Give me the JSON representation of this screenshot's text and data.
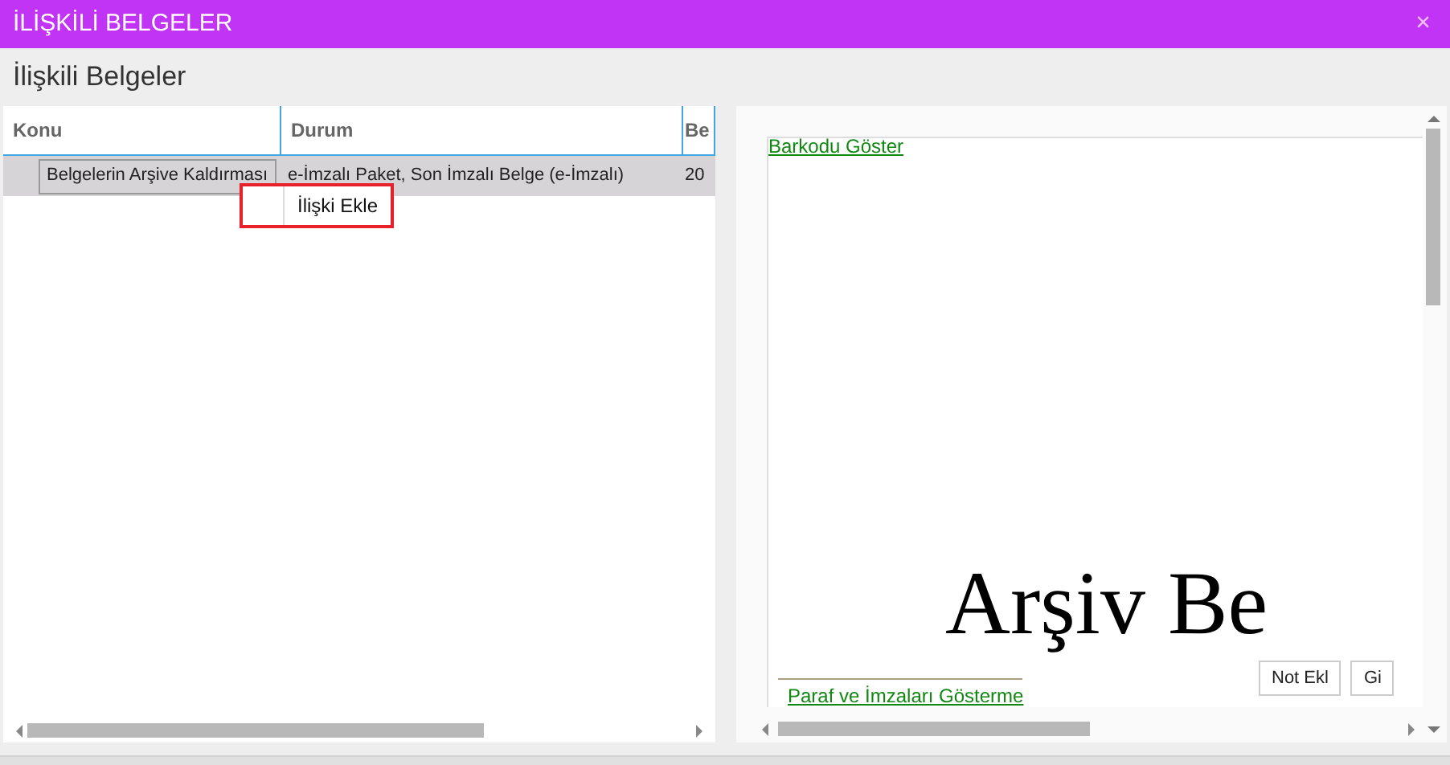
{
  "window": {
    "title": "İLİŞKİLİ BELGELER",
    "close": "×"
  },
  "heading": "İlişkili Belgeler",
  "table": {
    "columns": [
      "Konu",
      "Durum",
      "Be"
    ],
    "rows": [
      {
        "selected": true,
        "cells": [
          "Belgelerin Arşive Kaldırması",
          "e-İmzalı Paket, Son İmzalı Belge (e-İmzalı)",
          "20"
        ]
      }
    ]
  },
  "context_menu": {
    "items": [
      {
        "label": "İlişki Ekle",
        "highlighted": true
      }
    ]
  },
  "preview": {
    "barcode_link": "Barkodu Göster",
    "stamp_text": "Arşiv Be",
    "signatures_link": "Paraf ve İmzaları Gösterme",
    "buttons": [
      "Not Ekl",
      "Gi"
    ]
  }
}
